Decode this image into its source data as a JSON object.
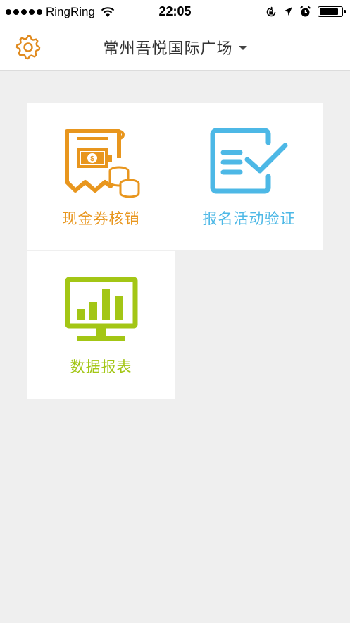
{
  "status_bar": {
    "carrier": "RingRing",
    "time": "22:05",
    "signal_bars": 5,
    "battery_level": 0.9
  },
  "nav": {
    "title": "常州吾悦国际广场",
    "settings_icon": "gear-icon",
    "dropdown_icon": "caret-down-icon"
  },
  "tiles": [
    {
      "label": "现金券核销",
      "icon": "receipt-coins-icon",
      "color": "#e8961e"
    },
    {
      "label": "报名活动验证",
      "icon": "checklist-icon",
      "color": "#4db8e6"
    },
    {
      "label": "数据报表",
      "icon": "monitor-chart-icon",
      "color": "#a3c615"
    }
  ],
  "colors": {
    "background": "#efefef",
    "settings_orange": "#e08a1e"
  }
}
